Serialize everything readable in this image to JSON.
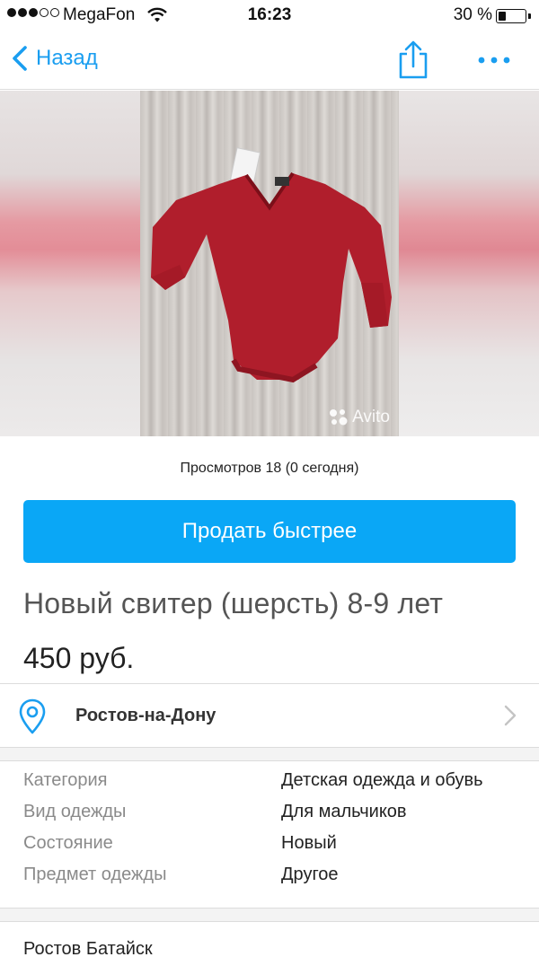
{
  "status_bar": {
    "carrier": "MegaFon",
    "time": "16:23",
    "battery_percent": "30 %",
    "battery_level": 0.3,
    "signal_bars": 3
  },
  "nav": {
    "back_label": "Назад",
    "icons": [
      "chevron-left-icon",
      "share-icon",
      "more-icon"
    ],
    "accent_color": "#1a9ef0"
  },
  "photo": {
    "watermark": "Avito"
  },
  "views": {
    "text": "Просмотров 18 (0 сегодня)"
  },
  "promo": {
    "button_label": "Продать быстрее",
    "button_color": "#0aa7f6"
  },
  "listing": {
    "title": "Новый свитер (шерсть) 8-9 лет",
    "price": "450 руб."
  },
  "location": {
    "city": "Ростов-на-Дону",
    "icon": "map-pin-icon"
  },
  "details": [
    {
      "label": "Категория",
      "value": "Детская одежда и обувь"
    },
    {
      "label": "Вид одежды",
      "value": "Для мальчиков"
    },
    {
      "label": "Состояние",
      "value": "Новый"
    },
    {
      "label": "Предмет одежды",
      "value": "Другое"
    }
  ],
  "description_partial": "Ростов Батайск"
}
